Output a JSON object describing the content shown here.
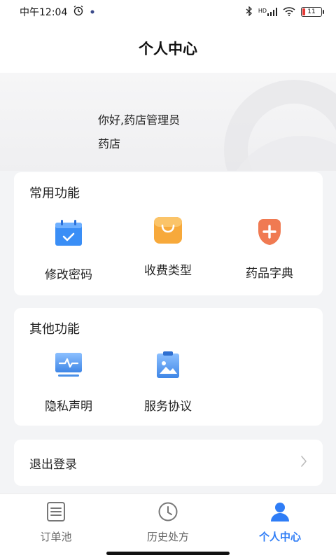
{
  "status_bar": {
    "time": "中午12:04",
    "signal_label": "HD",
    "battery_level": "11"
  },
  "header": {
    "title": "个人中心"
  },
  "profile": {
    "greeting": "你好,药店管理员",
    "store_type": "药店"
  },
  "common_functions": {
    "title": "常用功能",
    "items": [
      {
        "label": "修改密码",
        "icon": "calendar-check-icon",
        "color": "#3a8ef6"
      },
      {
        "label": "收费类型",
        "icon": "shopping-bag-icon",
        "color": "#f7a93b"
      },
      {
        "label": "药品字典",
        "icon": "medical-plus-icon",
        "color": "#f07a52"
      }
    ]
  },
  "other_functions": {
    "title": "其他功能",
    "items": [
      {
        "label": "隐私声明",
        "icon": "monitor-pulse-icon",
        "color": "#4a90e8"
      },
      {
        "label": "服务协议",
        "icon": "clipboard-image-icon",
        "color": "#4a90e8"
      }
    ]
  },
  "logout": {
    "label": "退出登录"
  },
  "tabs": [
    {
      "label": "订单池",
      "icon": "list-icon",
      "active": false
    },
    {
      "label": "历史处方",
      "icon": "clock-icon",
      "active": false
    },
    {
      "label": "个人中心",
      "icon": "user-icon",
      "active": true
    }
  ],
  "colors": {
    "accent": "#2f7df6",
    "background": "#f3f4f6"
  }
}
